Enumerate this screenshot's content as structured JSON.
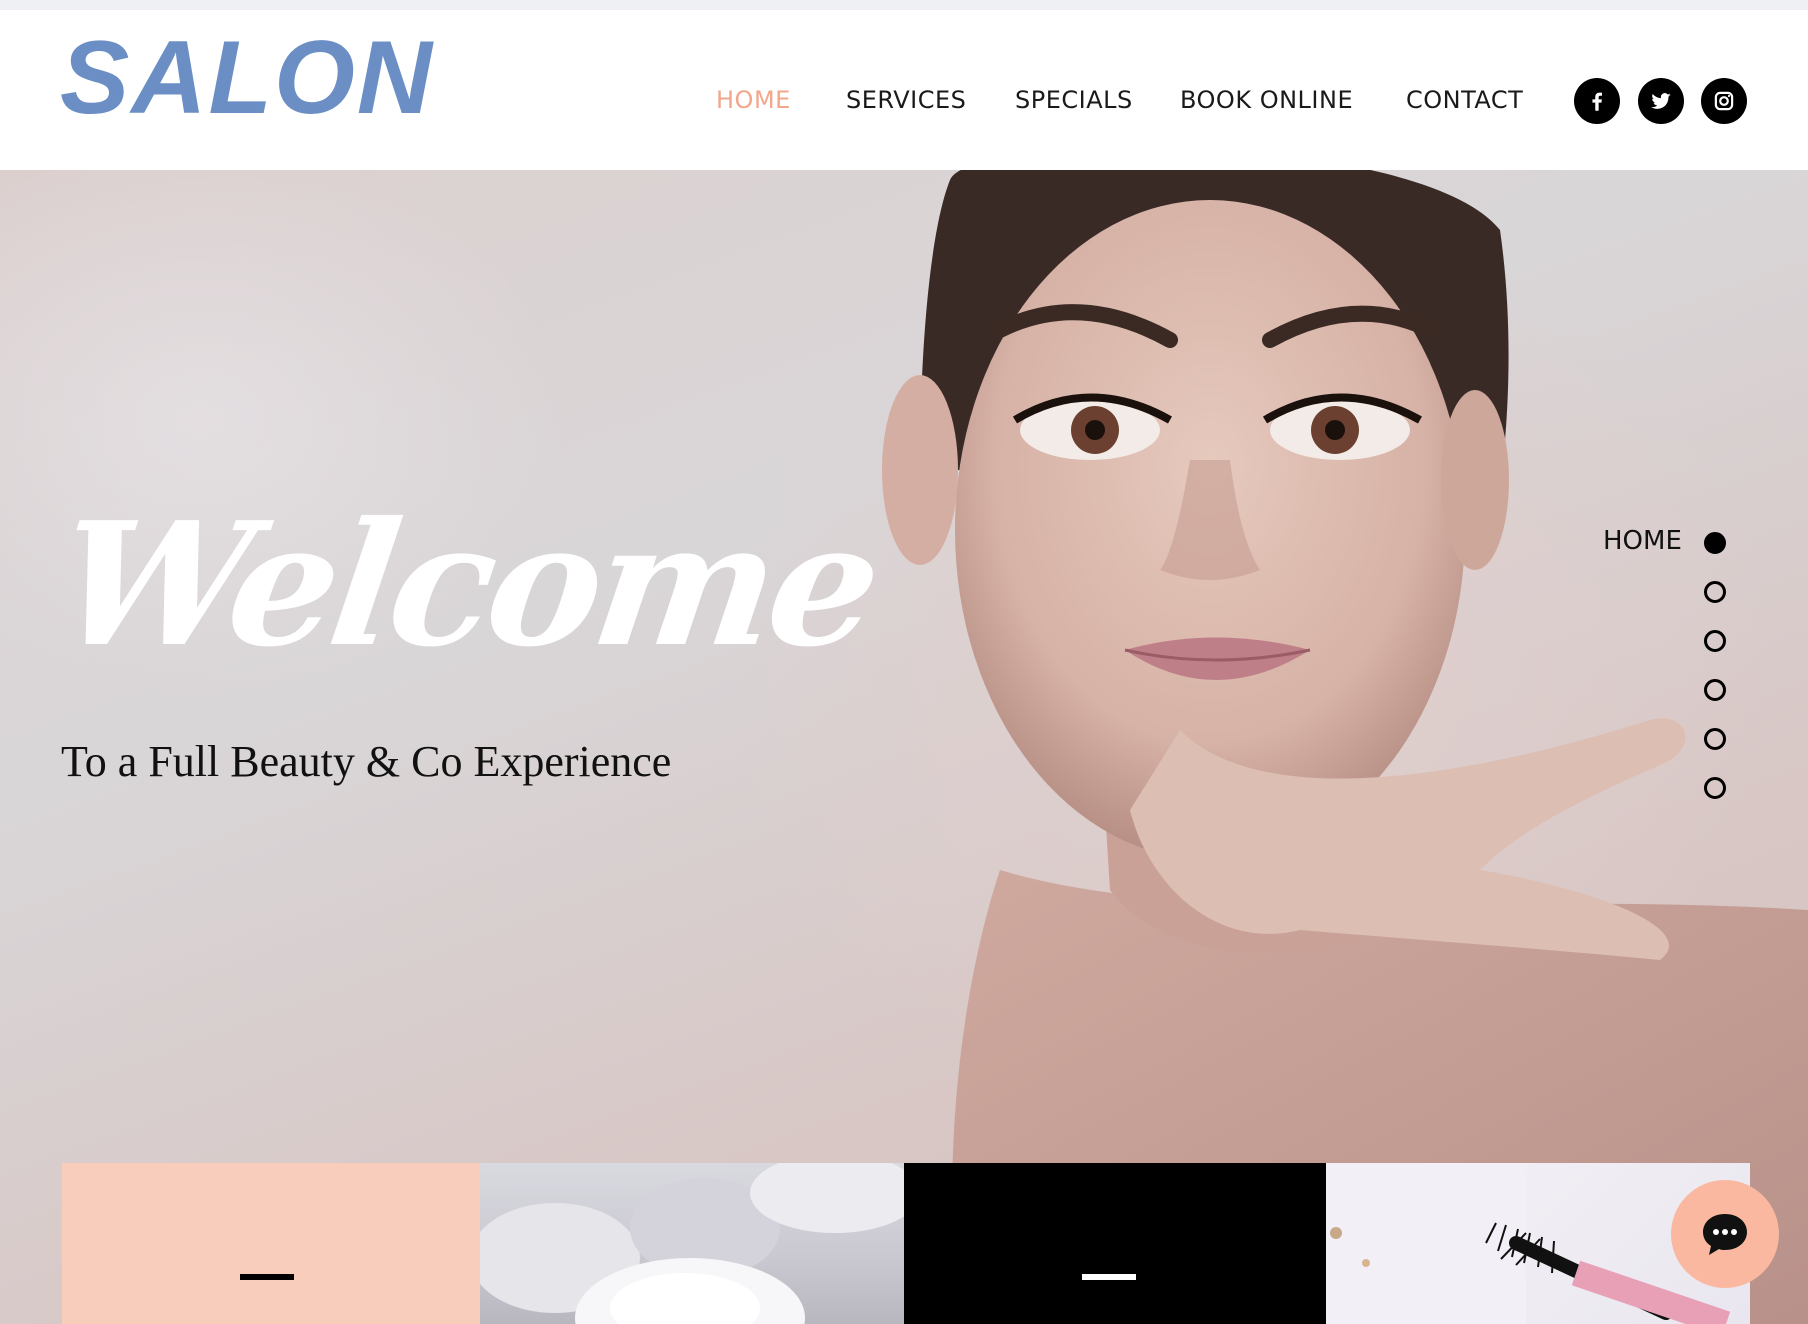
{
  "header": {
    "logo_text": "SALON",
    "nav": [
      {
        "label": "HOME",
        "active": true
      },
      {
        "label": "SERVICES",
        "active": false
      },
      {
        "label": "SPECIALS",
        "active": false
      },
      {
        "label": "BOOK ONLINE",
        "active": false
      },
      {
        "label": "CONTACT",
        "active": false
      }
    ],
    "social": [
      "facebook-icon",
      "twitter-icon",
      "instagram-icon"
    ]
  },
  "hero": {
    "headline": "Welcome",
    "subheadline": "To a Full Beauty & Co Experience"
  },
  "section_nav": {
    "current_label": "HOME",
    "dots": 6,
    "active_index": 0
  },
  "colors": {
    "accent": "#f2a68b",
    "logo": "#6b8fc4",
    "tile_peach": "#f9cdbc",
    "chat_button": "#f9b89f"
  },
  "chat": {
    "icon": "chat-bubble-icon"
  }
}
